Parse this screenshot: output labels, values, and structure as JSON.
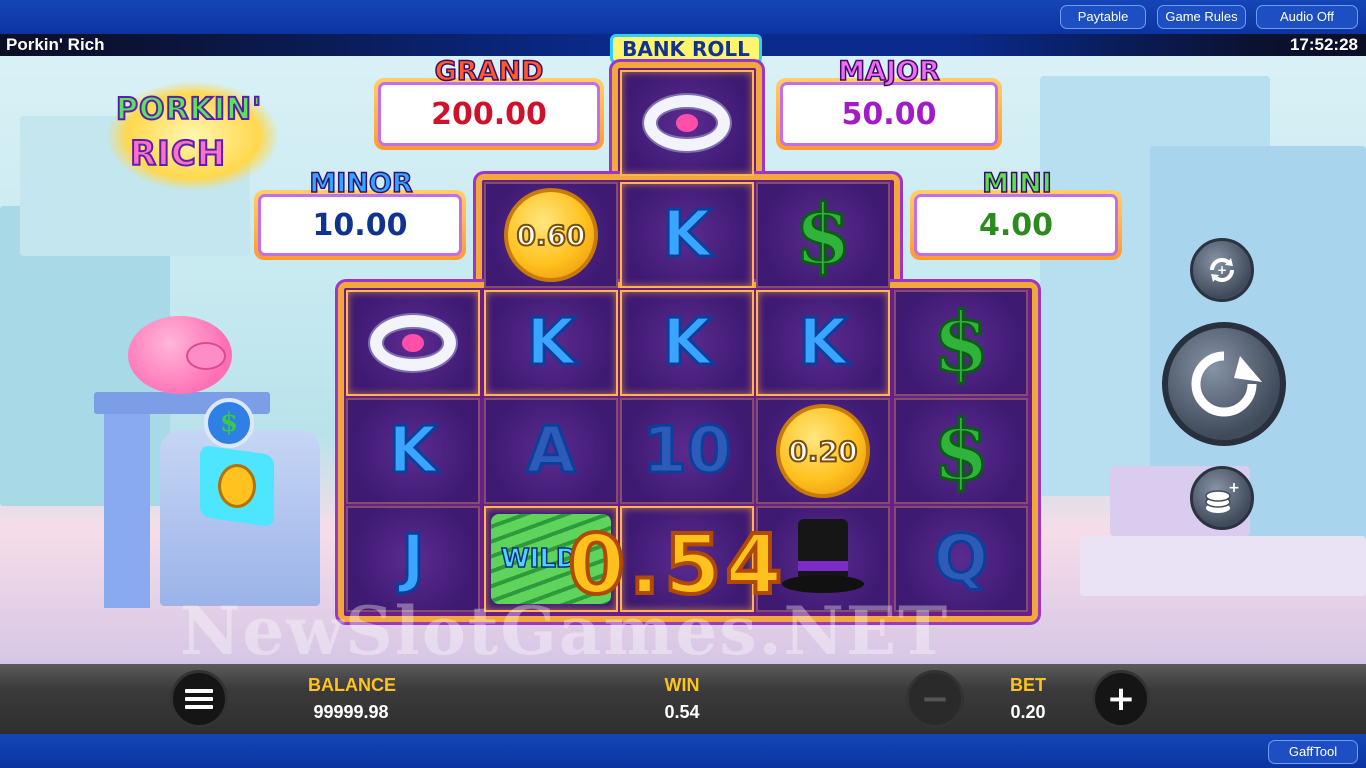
{
  "topbar": {
    "paytable_label": "Paytable",
    "game_rules_label": "Game Rules",
    "audio_label": "Audio Off"
  },
  "header": {
    "game_title": "Porkin' Rich",
    "clock": "17:52:28"
  },
  "logo": {
    "line1": "PORKIN'",
    "line2": "RICH"
  },
  "jackpots": {
    "bankroll_label": "BANK ROLL",
    "grand": {
      "label": "GRAND",
      "value": "200.00",
      "color": "#d0112b"
    },
    "major": {
      "label": "MAJOR",
      "value": "50.00",
      "color": "#a31ac8"
    },
    "minor": {
      "label": "MINOR",
      "value": "10.00",
      "color": "#10338f"
    },
    "mini": {
      "label": "MINI",
      "value": "4.00",
      "color": "#2d8a1f"
    }
  },
  "reels": {
    "bankroll_cell": {
      "symbol": "ring",
      "icon": "pig-ring-icon"
    },
    "top_row": [
      {
        "symbol": "coin",
        "value": "0.60"
      },
      {
        "symbol": "letter",
        "value": "K"
      },
      {
        "symbol": "dollar",
        "value": "$"
      }
    ],
    "grid": [
      [
        {
          "symbol": "ring",
          "value": ""
        },
        {
          "symbol": "letter",
          "value": "K"
        },
        {
          "symbol": "letter",
          "value": "J"
        }
      ],
      [
        {
          "symbol": "letter",
          "value": "K"
        },
        {
          "symbol": "letter",
          "value": "A"
        },
        {
          "symbol": "cash",
          "value": "WILD"
        }
      ],
      [
        {
          "symbol": "letter",
          "value": "K"
        },
        {
          "symbol": "letter",
          "value": "10"
        },
        {
          "symbol": "blank",
          "value": ""
        }
      ],
      [
        {
          "symbol": "letter",
          "value": "K"
        },
        {
          "symbol": "coin",
          "value": "0.20"
        },
        {
          "symbol": "hat",
          "value": ""
        }
      ],
      [
        {
          "symbol": "dollar",
          "value": "$"
        },
        {
          "symbol": "dollar",
          "value": "$"
        },
        {
          "symbol": "letter",
          "value": "Q"
        }
      ]
    ],
    "win_amount_overlay": "0.54"
  },
  "controls": {
    "autoplay_icon": "autoplay-icon",
    "spin_icon": "spin-icon",
    "bet_coins_icon": "coins-plus-icon"
  },
  "watermark": "NewSlotGames.NET",
  "bottombar": {
    "balance_label": "BALANCE",
    "balance_value": "99999.98",
    "win_label": "WIN",
    "win_value": "0.54",
    "bet_label": "BET",
    "bet_value": "0.20",
    "minus_glyph": "−",
    "plus_glyph": "+",
    "menu_icon": "menu-icon"
  },
  "footer": {
    "gafftool_label": "GaffTool"
  },
  "colors": {
    "topbar": "#1446b8",
    "reel_frame": "#f2a83a",
    "stat_label": "#ffc21f",
    "letter_blue": "#3aa5ff",
    "dollar_green": "#2fb33a"
  }
}
